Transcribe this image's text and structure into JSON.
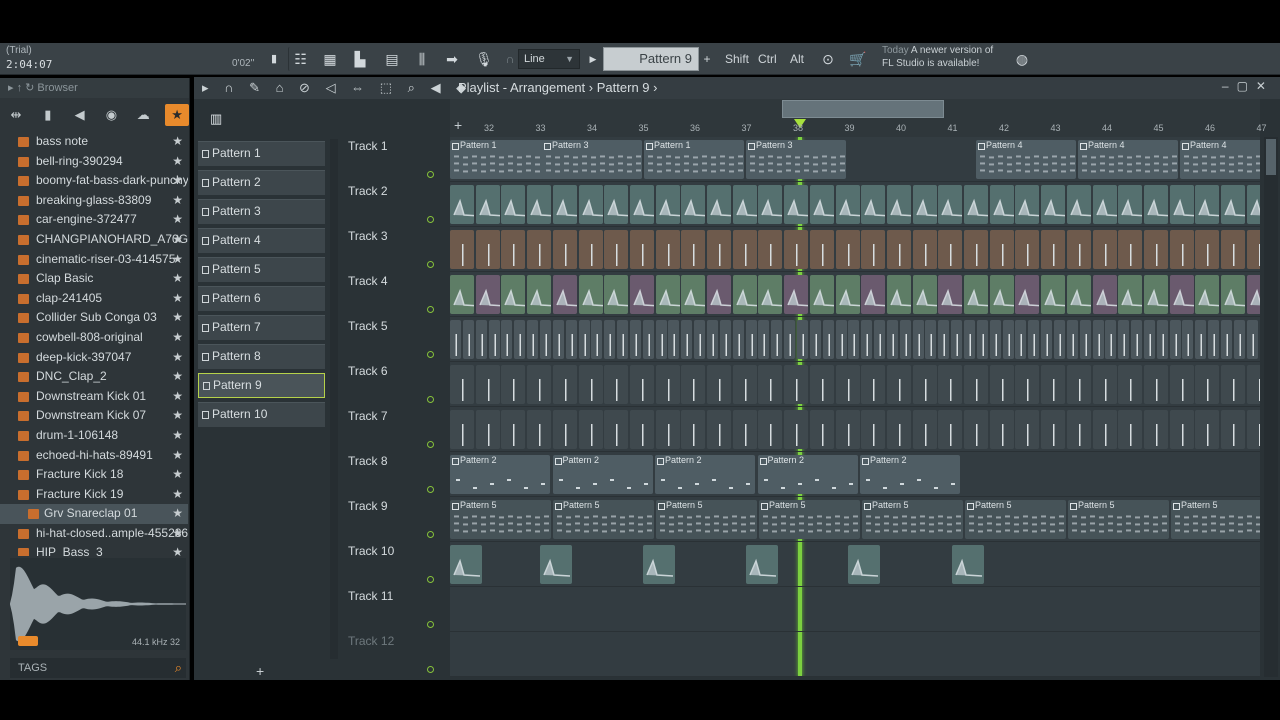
{
  "toolbar": {
    "trial_label": "(Trial)",
    "song_time": "2:04:07",
    "cpu_time": "0'02''",
    "snap_mode": "Line",
    "current_pattern": "Pattern 9",
    "mod_keys": [
      "Shift",
      "Ctrl",
      "Alt"
    ],
    "news_line1_dim": "Today",
    "news_line1": "A newer version of",
    "news_line2": "FL Studio is available!"
  },
  "browser": {
    "title": "Browser",
    "files": [
      "bass note",
      "bell-ring-390294",
      "boomy-fat-bass-dark-punchy",
      "breaking-glass-83809",
      "car-engine-372477",
      "CHANGPIANOHARD_A70GG",
      "cinematic-riser-03-414575",
      "Clap Basic",
      "clap-241405",
      "Collider Sub Conga 03",
      "cowbell-808-original",
      "deep-kick-397047",
      "DNC_Clap_2",
      "Downstream Kick 01",
      "Downstream Kick 07",
      "drum-1-106148",
      "echoed-hi-hats-89491",
      "Fracture Kick 18",
      "Fracture Kick 19",
      "Grv Snareclap 01",
      "hi-hat-closed..ample-455286",
      "HIP_Bass_3"
    ],
    "selected_index": 19,
    "sample_info": "44.1 kHz 32",
    "tags_label": "TAGS"
  },
  "playlist": {
    "title": "Playlist - Arrangement",
    "title_sep": "›",
    "current_pattern": "Pattern 9",
    "patterns": [
      "Pattern 1",
      "Pattern 2",
      "Pattern 3",
      "Pattern 4",
      "Pattern 5",
      "Pattern 6",
      "Pattern 7",
      "Pattern 8",
      "Pattern 9",
      "Pattern 10"
    ],
    "active_pattern_index": 8,
    "bar_numbers": [
      "32",
      "33",
      "34",
      "35",
      "36",
      "37",
      "38",
      "39",
      "40",
      "41",
      "42",
      "43",
      "44",
      "45",
      "46",
      "47"
    ],
    "tracks": [
      "Track 1",
      "Track 2",
      "Track 3",
      "Track 4",
      "Track 5",
      "Track 6",
      "Track 7",
      "Track 8",
      "Track 9",
      "Track 10",
      "Track 11",
      "Track 12"
    ],
    "track1_clips": [
      "Pattern 1",
      "Pattern 3",
      "Pattern 1",
      "Pattern 3",
      "Pattern 4",
      "Pattern 4",
      "Pattern 4"
    ],
    "track8_clips": [
      "Pattern 2",
      "Pattern 2",
      "Pattern 2",
      "Pattern 2",
      "Pattern 2"
    ],
    "track9_clips": [
      "Pattern 5",
      "Pattern 5",
      "Pattern 5",
      "Pattern 5",
      "Pattern 5",
      "Pattern 5",
      "Pattern 5",
      "Pattern 5"
    ],
    "playhead_bar": 37.95
  },
  "colors": {
    "accent_orange": "#e88a2c",
    "playhead_green": "#7cd040",
    "clip_teal": "#55706f",
    "clip_green": "#5e7d66",
    "clip_brown": "#6e5a4c",
    "clip_purple": "#6a5a6e",
    "clip_slate": "#4f5d64"
  },
  "icons": [
    "search-icon",
    "star-icon",
    "play-icon",
    "magnet-icon",
    "pencil-icon",
    "paint-icon",
    "delete-icon",
    "mute-icon",
    "slip-icon",
    "select-icon",
    "zoom-icon",
    "playback-icon",
    "mic-icon",
    "mixer-icon",
    "piano-roll-icon",
    "metronome-icon",
    "shop-icon",
    "globe-icon"
  ]
}
